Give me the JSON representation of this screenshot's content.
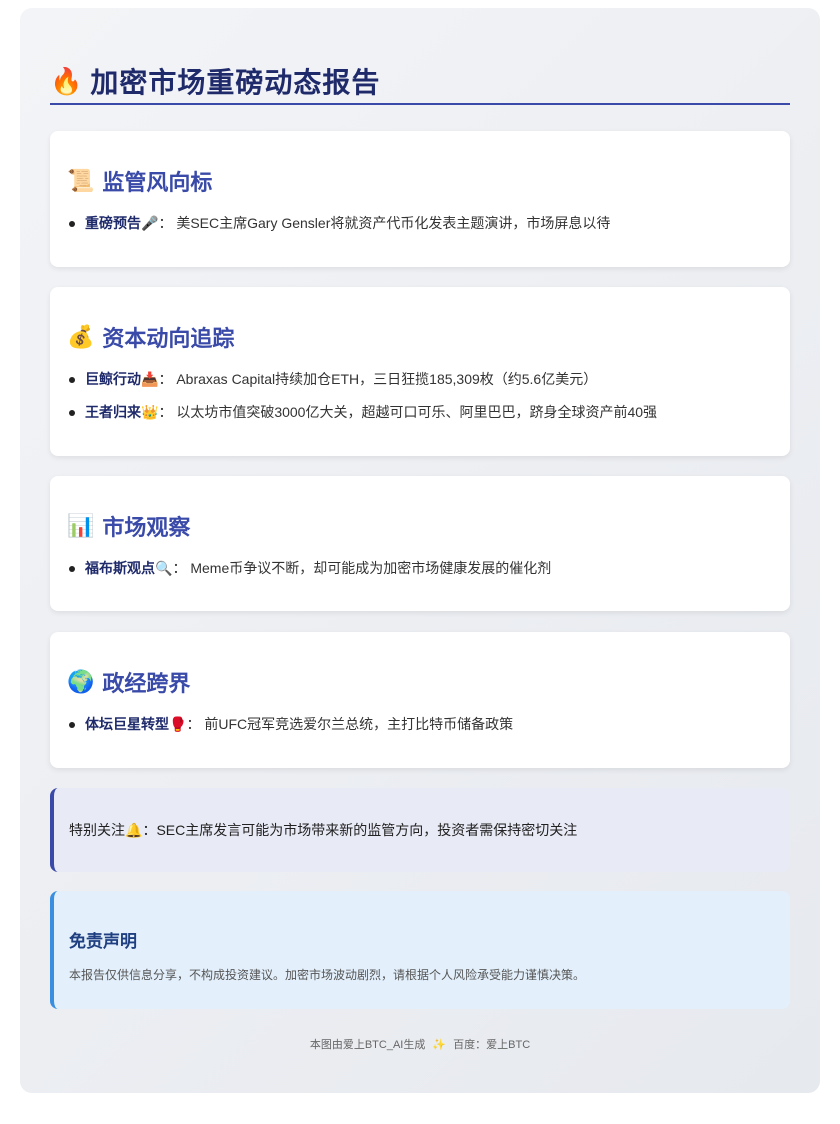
{
  "header": {
    "icon": "🔥",
    "title": "加密市场重磅动态报告"
  },
  "sections": [
    {
      "icon": "📜",
      "title": "监管风向标",
      "items": [
        {
          "label": "重磅预告",
          "emoji": "🎤",
          "text": "美SEC主席Gary Gensler将就资产代币化发表主题演讲，市场屏息以待"
        }
      ]
    },
    {
      "icon": "💰",
      "title": "资本动向追踪",
      "items": [
        {
          "label": "巨鲸行动",
          "emoji": "📥",
          "text": "Abraxas Capital持续加仓ETH，三日狂揽185,309枚（约5.6亿美元）"
        },
        {
          "label": "王者归来",
          "emoji": "👑",
          "text": "以太坊市值突破3000亿大关，超越可口可乐、阿里巴巴，跻身全球资产前40强"
        }
      ]
    },
    {
      "icon": "📊",
      "title": "市场观察",
      "items": [
        {
          "label": "福布斯观点",
          "emoji": "🔍",
          "text": "Meme币争议不断，却可能成为加密市场健康发展的催化剂"
        }
      ]
    },
    {
      "icon": "🌍",
      "title": "政经跨界",
      "items": [
        {
          "label": "体坛巨星转型",
          "emoji": "🥊",
          "text": "前UFC冠军竞选爱尔兰总统，主打比特币储备政策"
        }
      ]
    }
  ],
  "notice": {
    "label": "特别关注",
    "emoji": "🔔",
    "text": "SEC主席发言可能为市场带来新的监管方向，投资者需保持密切关注"
  },
  "disclaimer": {
    "title": "免责声明",
    "text": "本报告仅供信息分享，不构成投资建议。加密市场波动剧烈，请根据个人风险承受能力谨慎决策。"
  },
  "footer": {
    "generated": "本图由爱上BTC_AI生成",
    "emoji": "✨",
    "baidu": "百度：爱上BTC"
  },
  "colors": {
    "accent": "#3a4aa8",
    "title": "#1f2a6b",
    "info": "#3a8ee0"
  }
}
